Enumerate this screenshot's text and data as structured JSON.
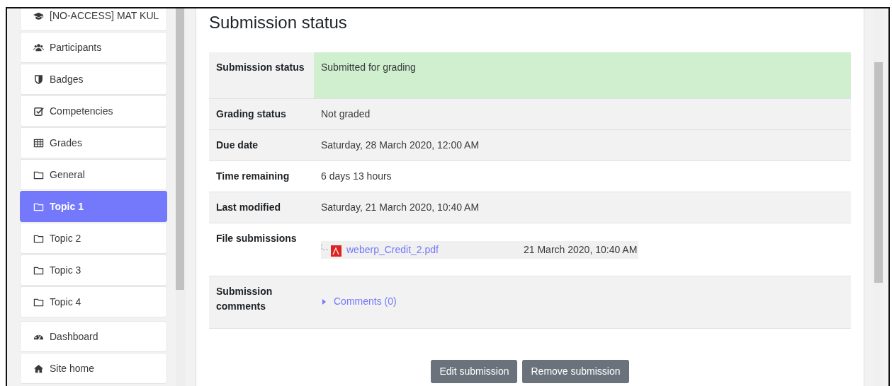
{
  "sidebar": {
    "groups": [
      [
        {
          "label": "[NO-ACCESS] MAT KUL",
          "kind": "course",
          "selected": false
        },
        {
          "label": "Participants",
          "kind": "participants",
          "selected": false
        },
        {
          "label": "Badges",
          "kind": "badges",
          "selected": false
        },
        {
          "label": "Competencies",
          "kind": "competencies",
          "selected": false
        },
        {
          "label": "Grades",
          "kind": "grades",
          "selected": false
        },
        {
          "label": "General",
          "kind": "section",
          "selected": false
        },
        {
          "label": "Topic 1",
          "kind": "section",
          "selected": true
        },
        {
          "label": "Topic 2",
          "kind": "section",
          "selected": false
        },
        {
          "label": "Topic 3",
          "kind": "section",
          "selected": false
        },
        {
          "label": "Topic 4",
          "kind": "section",
          "selected": false
        }
      ],
      [
        {
          "label": "Dashboard",
          "kind": "dashboard",
          "selected": false
        },
        {
          "label": "Site home",
          "kind": "home",
          "selected": false
        }
      ]
    ]
  },
  "heading": "Submission status",
  "rows": [
    {
      "label": "Submission status",
      "kind": "text",
      "value": "Submitted for grading",
      "highlighted": true
    },
    {
      "label": "Grading status",
      "kind": "text",
      "value": "Not graded",
      "highlighted": false
    },
    {
      "label": "Due date",
      "kind": "text",
      "value": "Saturday, 28 March 2020, 12:00 AM",
      "highlighted": false
    },
    {
      "label": "Time remaining",
      "kind": "text",
      "value": "6 days 13 hours",
      "highlighted": false
    },
    {
      "label": "Last modified",
      "kind": "text",
      "value": "Saturday, 21 March 2020, 10:40 AM",
      "highlighted": false
    },
    {
      "label": "File submissions",
      "kind": "file",
      "file_name": "weberp_Credit_2.pdf",
      "file_date": "21 March 2020, 10:40 AM"
    },
    {
      "label": "Submission comments",
      "kind": "comments",
      "link": "Comments (0)",
      "expanded": false
    }
  ],
  "buttons": [
    "Edit submission",
    "Remove submission"
  ]
}
